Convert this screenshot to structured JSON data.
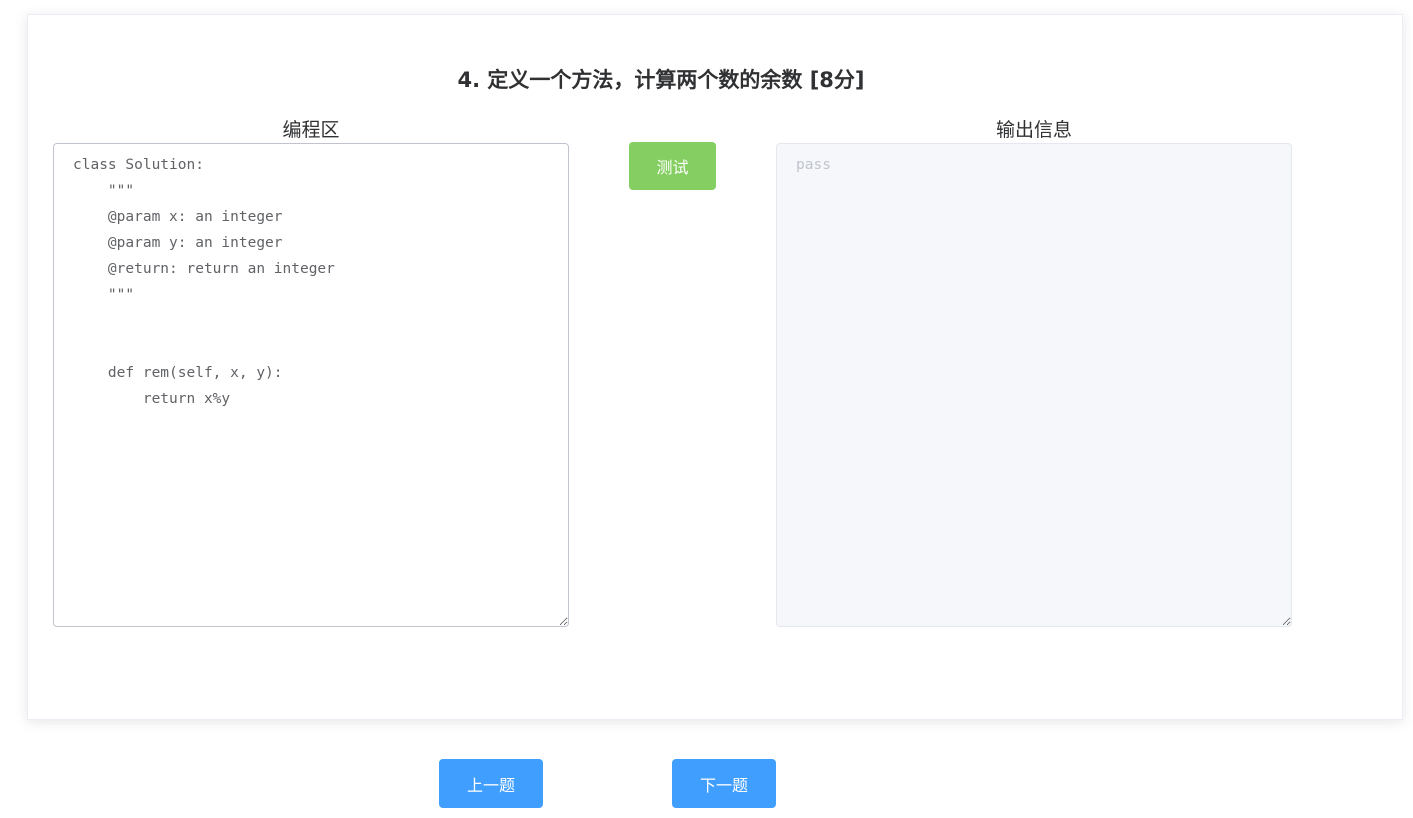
{
  "question": {
    "title": "4. 定义一个方法，计算两个数的余数 [8分]"
  },
  "code_panel": {
    "label": "编程区",
    "value": "class Solution:\n    \"\"\"\n    @param x: an integer\n    @param y: an integer\n    @return: return an integer\n    \"\"\"\n\n\n    def rem(self, x, y):\n        return x%y"
  },
  "test_button": {
    "label": "测试"
  },
  "output_panel": {
    "label": "输出信息",
    "placeholder": "pass"
  },
  "navigation": {
    "prev_label": "上一题",
    "next_label": "下一题"
  },
  "colors": {
    "test_button": "#85ce61",
    "nav_button": "#409eff",
    "output_background": "#f5f7fa"
  }
}
